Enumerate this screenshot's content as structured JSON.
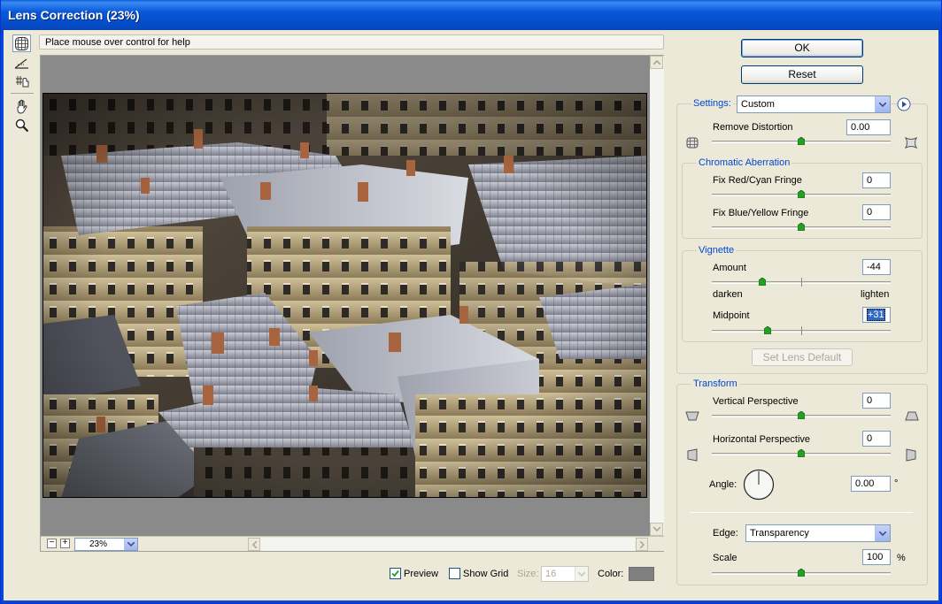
{
  "window": {
    "title": "Lens Correction (23%)"
  },
  "help": {
    "text": "Place mouse over control for help"
  },
  "tools": [
    {
      "name": "remove-distortion-tool"
    },
    {
      "name": "straighten-tool"
    },
    {
      "name": "move-grid-tool"
    },
    {
      "name": "hand-tool"
    },
    {
      "name": "zoom-tool"
    }
  ],
  "zoom": {
    "minus": "−",
    "plus": "+",
    "value": "23%"
  },
  "bottom": {
    "preview_label": "Preview",
    "preview_checked": true,
    "show_grid_label": "Show Grid",
    "show_grid_checked": false,
    "size_label": "Size:",
    "size_value": "16",
    "color_label": "Color:",
    "grid_color": "#808080"
  },
  "buttons": {
    "ok": "OK",
    "reset": "Reset",
    "set_lens_default": "Set Lens Default"
  },
  "settings": {
    "label": "Settings:",
    "value": "Custom",
    "remove_distortion_label": "Remove Distortion",
    "remove_distortion_value": "0.00"
  },
  "chromatic": {
    "title": "Chromatic Aberration",
    "red_cyan_label": "Fix Red/Cyan Fringe",
    "red_cyan_value": "0",
    "blue_yellow_label": "Fix Blue/Yellow Fringe",
    "blue_yellow_value": "0"
  },
  "vignette": {
    "title": "Vignette",
    "amount_label": "Amount",
    "amount_value": "-44",
    "darken_label": "darken",
    "lighten_label": "lighten",
    "midpoint_label": "Midpoint",
    "midpoint_value": "+31"
  },
  "transform": {
    "title": "Transform",
    "vertical_label": "Vertical Perspective",
    "vertical_value": "0",
    "horizontal_label": "Horizontal Perspective",
    "horizontal_value": "0",
    "angle_label": "Angle:",
    "angle_value": "0.00",
    "angle_unit": "°",
    "edge_label": "Edge:",
    "edge_value": "Transparency",
    "scale_label": "Scale",
    "scale_value": "100",
    "scale_unit": "%"
  },
  "colors": {
    "accent": "#0046d5",
    "title_bar": "#0550cf"
  }
}
